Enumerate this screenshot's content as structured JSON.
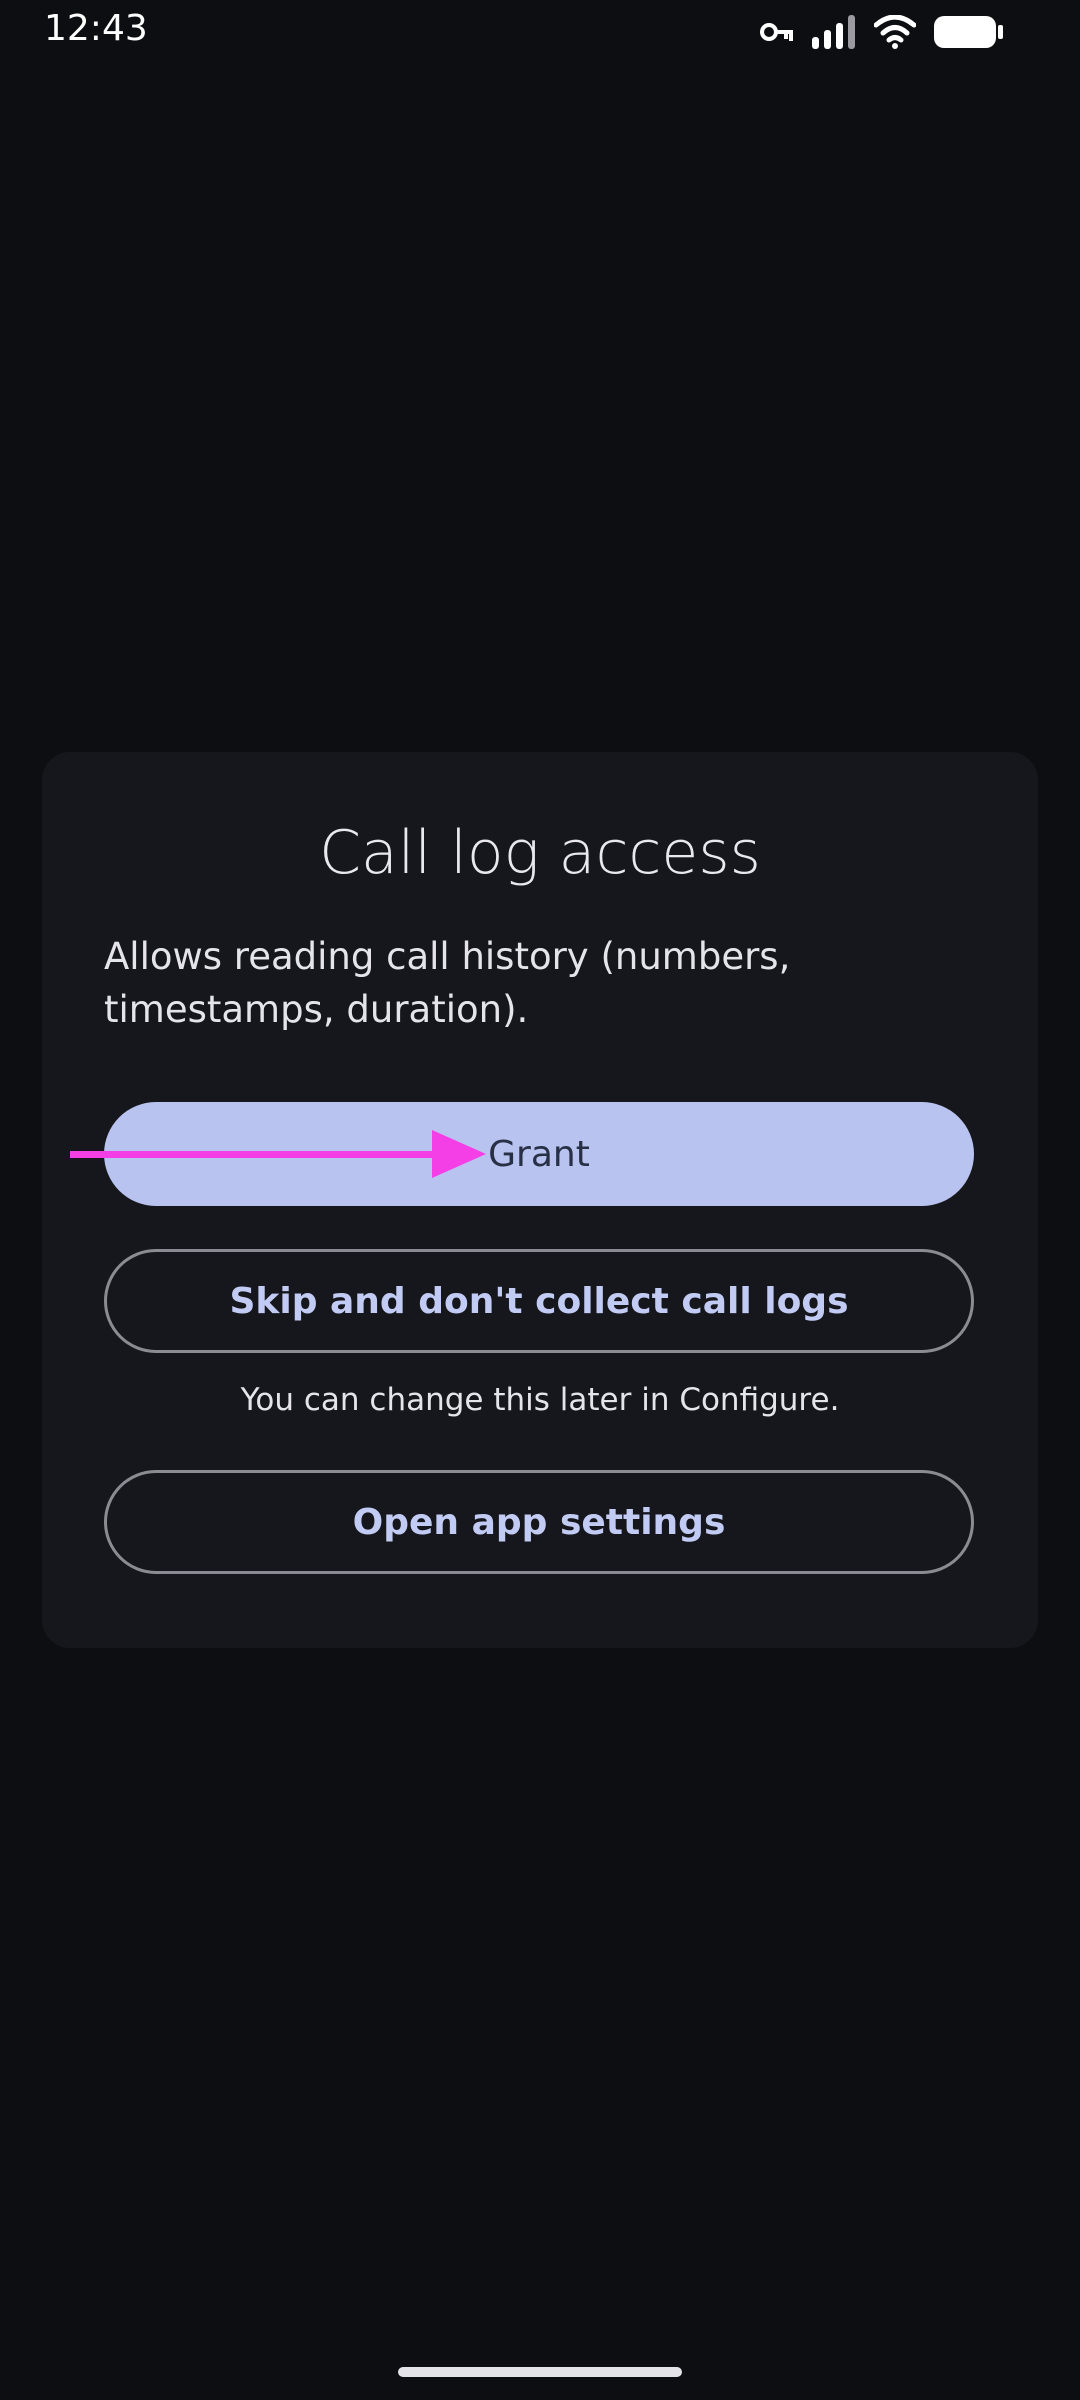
{
  "status_bar": {
    "time": "12:43",
    "icons": [
      "vpn-key-icon",
      "signal-icon",
      "wifi-icon",
      "battery-icon"
    ]
  },
  "dialog": {
    "title": "Call log access",
    "description": "Allows reading call history (numbers, timestamps, duration).",
    "grant_label": "Grant",
    "skip_label": "Skip and don't collect call logs",
    "hint": "You can change this later in Configure.",
    "settings_label": "Open app settings"
  },
  "colors": {
    "background": "#0d0e12",
    "card": "#16171c",
    "primary_button": "#b8c3ef",
    "primary_text": "#283046",
    "outline_text": "#c2cbf3",
    "annotation_arrow": "#f53fe6"
  }
}
